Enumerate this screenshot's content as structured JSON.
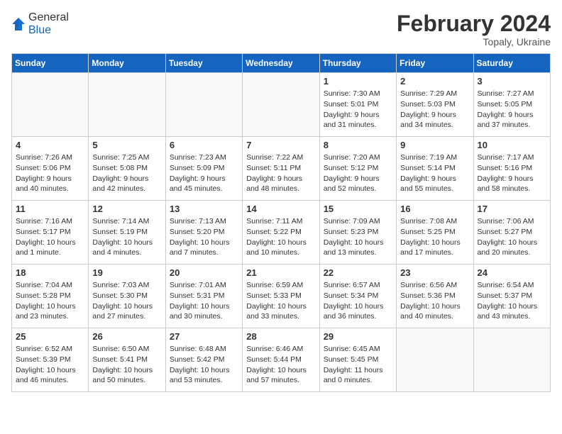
{
  "header": {
    "logo_general": "General",
    "logo_blue": "Blue",
    "month_title": "February 2024",
    "location": "Topaly, Ukraine"
  },
  "weekdays": [
    "Sunday",
    "Monday",
    "Tuesday",
    "Wednesday",
    "Thursday",
    "Friday",
    "Saturday"
  ],
  "weeks": [
    [
      {
        "day": "",
        "info": ""
      },
      {
        "day": "",
        "info": ""
      },
      {
        "day": "",
        "info": ""
      },
      {
        "day": "",
        "info": ""
      },
      {
        "day": "1",
        "info": "Sunrise: 7:30 AM\nSunset: 5:01 PM\nDaylight: 9 hours\nand 31 minutes."
      },
      {
        "day": "2",
        "info": "Sunrise: 7:29 AM\nSunset: 5:03 PM\nDaylight: 9 hours\nand 34 minutes."
      },
      {
        "day": "3",
        "info": "Sunrise: 7:27 AM\nSunset: 5:05 PM\nDaylight: 9 hours\nand 37 minutes."
      }
    ],
    [
      {
        "day": "4",
        "info": "Sunrise: 7:26 AM\nSunset: 5:06 PM\nDaylight: 9 hours\nand 40 minutes."
      },
      {
        "day": "5",
        "info": "Sunrise: 7:25 AM\nSunset: 5:08 PM\nDaylight: 9 hours\nand 42 minutes."
      },
      {
        "day": "6",
        "info": "Sunrise: 7:23 AM\nSunset: 5:09 PM\nDaylight: 9 hours\nand 45 minutes."
      },
      {
        "day": "7",
        "info": "Sunrise: 7:22 AM\nSunset: 5:11 PM\nDaylight: 9 hours\nand 48 minutes."
      },
      {
        "day": "8",
        "info": "Sunrise: 7:20 AM\nSunset: 5:12 PM\nDaylight: 9 hours\nand 52 minutes."
      },
      {
        "day": "9",
        "info": "Sunrise: 7:19 AM\nSunset: 5:14 PM\nDaylight: 9 hours\nand 55 minutes."
      },
      {
        "day": "10",
        "info": "Sunrise: 7:17 AM\nSunset: 5:16 PM\nDaylight: 9 hours\nand 58 minutes."
      }
    ],
    [
      {
        "day": "11",
        "info": "Sunrise: 7:16 AM\nSunset: 5:17 PM\nDaylight: 10 hours\nand 1 minute."
      },
      {
        "day": "12",
        "info": "Sunrise: 7:14 AM\nSunset: 5:19 PM\nDaylight: 10 hours\nand 4 minutes."
      },
      {
        "day": "13",
        "info": "Sunrise: 7:13 AM\nSunset: 5:20 PM\nDaylight: 10 hours\nand 7 minutes."
      },
      {
        "day": "14",
        "info": "Sunrise: 7:11 AM\nSunset: 5:22 PM\nDaylight: 10 hours\nand 10 minutes."
      },
      {
        "day": "15",
        "info": "Sunrise: 7:09 AM\nSunset: 5:23 PM\nDaylight: 10 hours\nand 13 minutes."
      },
      {
        "day": "16",
        "info": "Sunrise: 7:08 AM\nSunset: 5:25 PM\nDaylight: 10 hours\nand 17 minutes."
      },
      {
        "day": "17",
        "info": "Sunrise: 7:06 AM\nSunset: 5:27 PM\nDaylight: 10 hours\nand 20 minutes."
      }
    ],
    [
      {
        "day": "18",
        "info": "Sunrise: 7:04 AM\nSunset: 5:28 PM\nDaylight: 10 hours\nand 23 minutes."
      },
      {
        "day": "19",
        "info": "Sunrise: 7:03 AM\nSunset: 5:30 PM\nDaylight: 10 hours\nand 27 minutes."
      },
      {
        "day": "20",
        "info": "Sunrise: 7:01 AM\nSunset: 5:31 PM\nDaylight: 10 hours\nand 30 minutes."
      },
      {
        "day": "21",
        "info": "Sunrise: 6:59 AM\nSunset: 5:33 PM\nDaylight: 10 hours\nand 33 minutes."
      },
      {
        "day": "22",
        "info": "Sunrise: 6:57 AM\nSunset: 5:34 PM\nDaylight: 10 hours\nand 36 minutes."
      },
      {
        "day": "23",
        "info": "Sunrise: 6:56 AM\nSunset: 5:36 PM\nDaylight: 10 hours\nand 40 minutes."
      },
      {
        "day": "24",
        "info": "Sunrise: 6:54 AM\nSunset: 5:37 PM\nDaylight: 10 hours\nand 43 minutes."
      }
    ],
    [
      {
        "day": "25",
        "info": "Sunrise: 6:52 AM\nSunset: 5:39 PM\nDaylight: 10 hours\nand 46 minutes."
      },
      {
        "day": "26",
        "info": "Sunrise: 6:50 AM\nSunset: 5:41 PM\nDaylight: 10 hours\nand 50 minutes."
      },
      {
        "day": "27",
        "info": "Sunrise: 6:48 AM\nSunset: 5:42 PM\nDaylight: 10 hours\nand 53 minutes."
      },
      {
        "day": "28",
        "info": "Sunrise: 6:46 AM\nSunset: 5:44 PM\nDaylight: 10 hours\nand 57 minutes."
      },
      {
        "day": "29",
        "info": "Sunrise: 6:45 AM\nSunset: 5:45 PM\nDaylight: 11 hours\nand 0 minutes."
      },
      {
        "day": "",
        "info": ""
      },
      {
        "day": "",
        "info": ""
      }
    ]
  ]
}
